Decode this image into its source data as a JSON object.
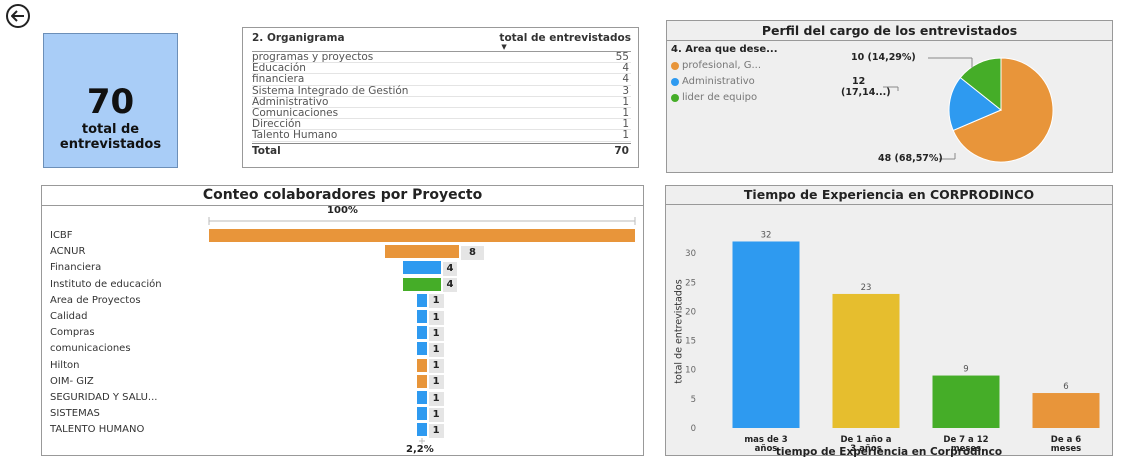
{
  "colors": {
    "orange": "#e8953a",
    "blue": "#2e9af0",
    "green": "#45ad28",
    "yellow": "#e6be2e",
    "kpi_bg": "#a9cdf7"
  },
  "nav": {
    "back_icon": "back-arrow-icon"
  },
  "kpi": {
    "value": "70",
    "label_line1": "total de",
    "label_line2": "entrevistados"
  },
  "org_table": {
    "header_col1": "2. Organigrama",
    "header_col2": "total de entrevistados",
    "rows": [
      {
        "name": "programas y proyectos",
        "value": "55"
      },
      {
        "name": "Educación",
        "value": "4"
      },
      {
        "name": "financiera",
        "value": "4"
      },
      {
        "name": "Sistema Integrado de Gestión",
        "value": "3"
      },
      {
        "name": "Administrativo",
        "value": "1"
      },
      {
        "name": "Comunicaciones",
        "value": "1"
      },
      {
        "name": "Dirección",
        "value": "1"
      },
      {
        "name": "Talento Humano",
        "value": "1"
      }
    ],
    "total_label": "Total",
    "total_value": "70"
  },
  "pie_panel": {
    "title": "Perfil del cargo de los entrevistados",
    "legend_title": "4. Area que dese...",
    "legend": [
      {
        "label": "profesional, G...",
        "color": "#e8953a"
      },
      {
        "label": "Administrativo",
        "color": "#2e9af0"
      },
      {
        "label": "lider de equipo",
        "color": "#45ad28"
      }
    ],
    "label_green": "10 (14,29%)",
    "label_blue_1": "12",
    "label_blue_2": "(17,14...)",
    "label_orange": "48 (68,57%)"
  },
  "funnel_panel": {
    "title": "Conteo colaboradores por Proyecto",
    "top_pct": "100%",
    "bottom_pct": "2,2%",
    "rows": [
      {
        "name": "ICBF",
        "value": 46,
        "label": "",
        "color": "#e8953a"
      },
      {
        "name": "ACNUR",
        "value": 8,
        "label": "8",
        "color": "#e8953a"
      },
      {
        "name": "Financiera",
        "value": 4,
        "label": "4",
        "color": "#2e9af0"
      },
      {
        "name": "Instituto de educación",
        "value": 4,
        "label": "4",
        "color": "#45ad28"
      },
      {
        "name": "Area de Proyectos",
        "value": 1,
        "label": "1",
        "color": "#2e9af0"
      },
      {
        "name": "Calidad",
        "value": 1,
        "label": "1",
        "color": "#2e9af0"
      },
      {
        "name": "Compras",
        "value": 1,
        "label": "1",
        "color": "#2e9af0"
      },
      {
        "name": "comunicaciones",
        "value": 1,
        "label": "1",
        "color": "#2e9af0"
      },
      {
        "name": "Hilton",
        "value": 1,
        "label": "1",
        "color": "#e8953a"
      },
      {
        "name": "OIM- GIZ",
        "value": 1,
        "label": "1",
        "color": "#e8953a"
      },
      {
        "name": "SEGURIDAD Y SALU...",
        "value": 1,
        "label": "1",
        "color": "#2e9af0"
      },
      {
        "name": "SISTEMAS",
        "value": 1,
        "label": "1",
        "color": "#2e9af0"
      },
      {
        "name": "TALENTO HUMANO",
        "value": 1,
        "label": "1",
        "color": "#2e9af0"
      }
    ]
  },
  "chart_data": {
    "type": "bar",
    "title": "Tiempo de Experiencia en CORPRODINCO",
    "xlabel": "tiempo de Experiencia en Corprodinco",
    "ylabel": "total de entrevistados",
    "categories": [
      [
        "mas de 3",
        "años"
      ],
      [
        "De 1 año a",
        "3 años"
      ],
      [
        "De 7 a 12",
        "meses"
      ],
      [
        "De a 6",
        "meses"
      ]
    ],
    "values": [
      32,
      23,
      9,
      6
    ],
    "colors": [
      "#2e9af0",
      "#e6be2e",
      "#45ad28",
      "#e8953a"
    ],
    "ylim": [
      0,
      35
    ],
    "yticks": [
      "0",
      "5",
      "10",
      "15",
      "20",
      "25",
      "30"
    ]
  }
}
